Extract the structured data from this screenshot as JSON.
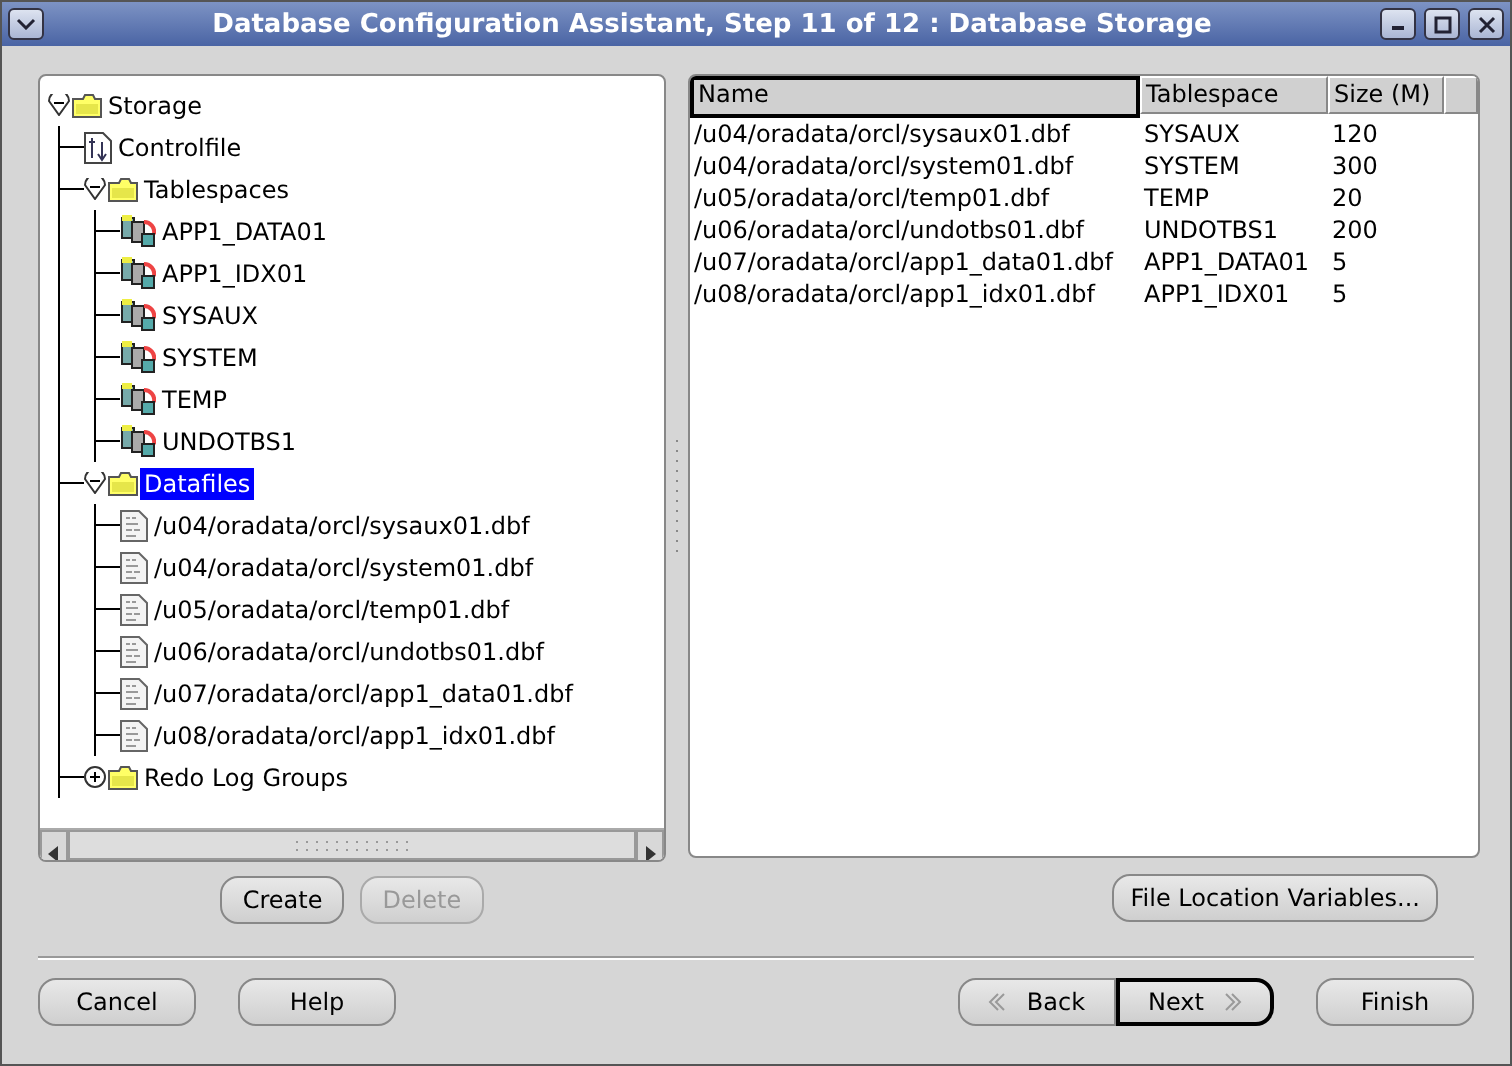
{
  "window": {
    "title": "Database Configuration Assistant, Step 11 of 12 : Database Storage"
  },
  "tree": [
    {
      "label": "Storage",
      "kind": "folder",
      "expanded": true,
      "selected": false,
      "children": [
        {
          "label": "Controlfile",
          "kind": "controlfile",
          "selected": false
        },
        {
          "label": "Tablespaces",
          "kind": "folder",
          "expanded": true,
          "selected": false,
          "children": [
            {
              "label": "APP1_DATA01",
              "kind": "tablespace",
              "selected": false
            },
            {
              "label": "APP1_IDX01",
              "kind": "tablespace",
              "selected": false
            },
            {
              "label": "SYSAUX",
              "kind": "tablespace",
              "selected": false
            },
            {
              "label": "SYSTEM",
              "kind": "tablespace",
              "selected": false
            },
            {
              "label": "TEMP",
              "kind": "tablespace",
              "selected": false
            },
            {
              "label": "UNDOTBS1",
              "kind": "tablespace",
              "selected": false
            }
          ]
        },
        {
          "label": "Datafiles",
          "kind": "folder",
          "expanded": true,
          "selected": true,
          "children": [
            {
              "label": "/u04/oradata/orcl/sysaux01.dbf",
              "kind": "datafile",
              "selected": false
            },
            {
              "label": "/u04/oradata/orcl/system01.dbf",
              "kind": "datafile",
              "selected": false
            },
            {
              "label": "/u05/oradata/orcl/temp01.dbf",
              "kind": "datafile",
              "selected": false
            },
            {
              "label": "/u06/oradata/orcl/undotbs01.dbf",
              "kind": "datafile",
              "selected": false
            },
            {
              "label": "/u07/oradata/orcl/app1_data01.dbf",
              "kind": "datafile",
              "selected": false
            },
            {
              "label": "/u08/oradata/orcl/app1_idx01.dbf",
              "kind": "datafile",
              "selected": false
            }
          ]
        },
        {
          "label": "Redo Log Groups",
          "kind": "folder",
          "expanded": false,
          "selected": false
        }
      ]
    }
  ],
  "tree_buttons": [
    {
      "label": "Create",
      "disabled": false
    },
    {
      "label": "Delete",
      "disabled": true
    }
  ],
  "table": {
    "columns": [
      {
        "label": "Name",
        "focused": true
      },
      {
        "label": "Tablespace",
        "focused": false
      },
      {
        "label": "Size (M)",
        "focused": false
      }
    ],
    "rows": [
      [
        "/u04/oradata/orcl/sysaux01.dbf",
        "SYSAUX",
        "120"
      ],
      [
        "/u04/oradata/orcl/system01.dbf",
        "SYSTEM",
        "300"
      ],
      [
        "/u05/oradata/orcl/temp01.dbf",
        "TEMP",
        "20"
      ],
      [
        "/u06/oradata/orcl/undotbs01.dbf",
        "UNDOTBS1",
        "200"
      ],
      [
        "/u07/oradata/orcl/app1_data01.dbf",
        "APP1_DATA01",
        "5"
      ],
      [
        "/u08/oradata/orcl/app1_idx01.dbf",
        "APP1_IDX01",
        "5"
      ]
    ]
  },
  "file_location_button": "File Location Variables...",
  "nav_buttons": [
    {
      "label": "Cancel",
      "kind": "plain",
      "default": false
    },
    {
      "label": "Help",
      "kind": "plain",
      "default": false
    },
    {
      "label": "Back",
      "kind": "back",
      "default": false
    },
    {
      "label": "Next",
      "kind": "next",
      "default": true
    },
    {
      "label": "Finish",
      "kind": "plain",
      "default": false
    }
  ]
}
